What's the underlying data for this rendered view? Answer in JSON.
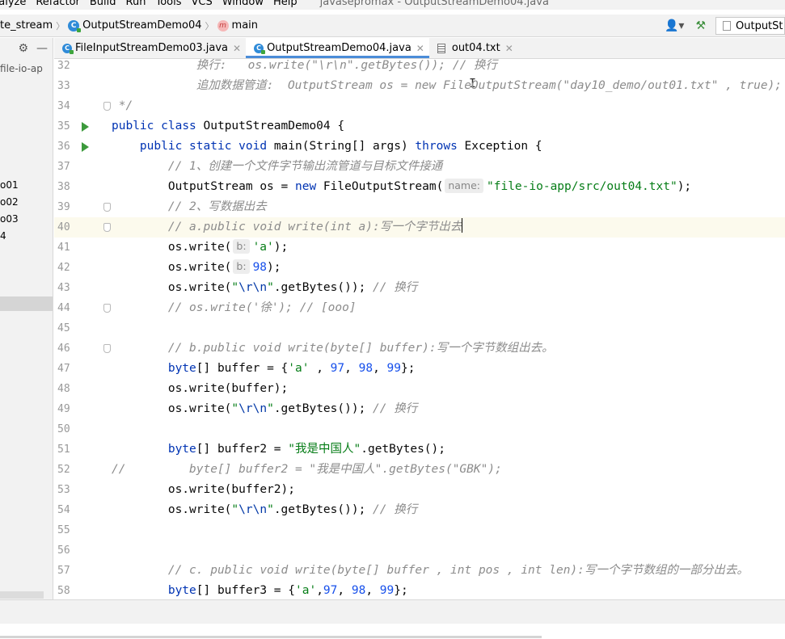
{
  "menu": {
    "items": [
      "nalyze",
      "Refactor",
      "Build",
      "Run",
      "Tools",
      "VCS",
      "Window",
      "Help"
    ],
    "window_title": "javasepromax - OutputStreamDemo04.java"
  },
  "navbar": {
    "crumbs": [
      "te_stream",
      "OutputStreamDemo04",
      "main"
    ],
    "run_config": "OutputSt"
  },
  "project": {
    "path": "\\file-io-ap",
    "items": [
      "o01",
      "o02",
      "o03",
      "4"
    ]
  },
  "tabs": [
    {
      "label": "FileInputStreamDemo03.java",
      "active": false
    },
    {
      "label": "OutputStreamDemo04.java",
      "active": true
    },
    {
      "label": "out04.txt",
      "active": false
    }
  ],
  "editor": {
    "lines": [
      {
        "n": "32",
        "text": "            换行:   os.write(\"\\r\\n\".getBytes()); // 换行"
      },
      {
        "n": "33",
        "text": "            追加数据管道:  OutputStream os = new FileOutputStream(\"day10_demo/out01.txt\" , true);"
      },
      {
        "n": "34",
        "text": " */"
      },
      {
        "n": "35",
        "text": "public class OutputStreamDemo04 {"
      },
      {
        "n": "36",
        "text": "    public static void main(String[] args) throws Exception {"
      },
      {
        "n": "37",
        "text": "        // 1、创建一个文件字节输出流管道与目标文件接通"
      },
      {
        "n": "38",
        "pre": "        OutputStream os = new FileOutputStream(",
        "hint": "name:",
        "post": "\"file-io-app/src/out04.txt\");"
      },
      {
        "n": "39",
        "text": "        // 2、写数据出去"
      },
      {
        "n": "40",
        "text": "        // a.public void write(int a):写一个字节出去"
      },
      {
        "n": "41",
        "pre": "        os.write(",
        "hint": "b:",
        "post": "'a');"
      },
      {
        "n": "42",
        "pre": "        os.write(",
        "hint": "b:",
        "post": "98);"
      },
      {
        "n": "43",
        "text": "        os.write(\"\\r\\n\".getBytes()); // 换行"
      },
      {
        "n": "44",
        "text": "        // os.write('徐'); // [ooo]"
      },
      {
        "n": "45",
        "text": ""
      },
      {
        "n": "46",
        "text": "        // b.public void write(byte[] buffer):写一个字节数组出去。"
      },
      {
        "n": "47",
        "text": "        byte[] buffer = {'a' , 97, 98, 99};"
      },
      {
        "n": "48",
        "text": "        os.write(buffer);"
      },
      {
        "n": "49",
        "text": "        os.write(\"\\r\\n\".getBytes()); // 换行"
      },
      {
        "n": "50",
        "text": ""
      },
      {
        "n": "51",
        "text": "        byte[] buffer2 = \"我是中国人\".getBytes();"
      },
      {
        "n": "52",
        "text": "//         byte[] buffer2 = \"我是中国人\".getBytes(\"GBK\");"
      },
      {
        "n": "53",
        "text": "        os.write(buffer2);"
      },
      {
        "n": "54",
        "text": "        os.write(\"\\r\\n\".getBytes()); // 换行"
      },
      {
        "n": "55",
        "text": ""
      },
      {
        "n": "56",
        "text": ""
      },
      {
        "n": "57",
        "text": "        // c. public void write(byte[] buffer , int pos , int len):写一个字节数组的一部分出去。"
      },
      {
        "n": "58",
        "text": "        byte[] buffer3 = {'a',97, 98, 99};"
      }
    ]
  }
}
